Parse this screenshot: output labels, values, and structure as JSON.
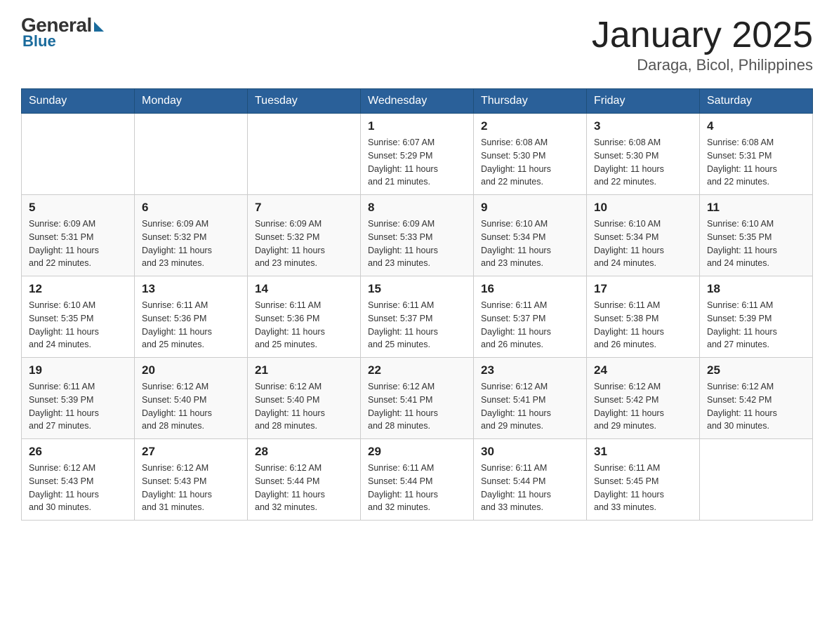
{
  "logo": {
    "general": "General",
    "blue": "Blue"
  },
  "title": "January 2025",
  "location": "Daraga, Bicol, Philippines",
  "days_of_week": [
    "Sunday",
    "Monday",
    "Tuesday",
    "Wednesday",
    "Thursday",
    "Friday",
    "Saturday"
  ],
  "weeks": [
    [
      {
        "day": "",
        "info": ""
      },
      {
        "day": "",
        "info": ""
      },
      {
        "day": "",
        "info": ""
      },
      {
        "day": "1",
        "info": "Sunrise: 6:07 AM\nSunset: 5:29 PM\nDaylight: 11 hours\nand 21 minutes."
      },
      {
        "day": "2",
        "info": "Sunrise: 6:08 AM\nSunset: 5:30 PM\nDaylight: 11 hours\nand 22 minutes."
      },
      {
        "day": "3",
        "info": "Sunrise: 6:08 AM\nSunset: 5:30 PM\nDaylight: 11 hours\nand 22 minutes."
      },
      {
        "day": "4",
        "info": "Sunrise: 6:08 AM\nSunset: 5:31 PM\nDaylight: 11 hours\nand 22 minutes."
      }
    ],
    [
      {
        "day": "5",
        "info": "Sunrise: 6:09 AM\nSunset: 5:31 PM\nDaylight: 11 hours\nand 22 minutes."
      },
      {
        "day": "6",
        "info": "Sunrise: 6:09 AM\nSunset: 5:32 PM\nDaylight: 11 hours\nand 23 minutes."
      },
      {
        "day": "7",
        "info": "Sunrise: 6:09 AM\nSunset: 5:32 PM\nDaylight: 11 hours\nand 23 minutes."
      },
      {
        "day": "8",
        "info": "Sunrise: 6:09 AM\nSunset: 5:33 PM\nDaylight: 11 hours\nand 23 minutes."
      },
      {
        "day": "9",
        "info": "Sunrise: 6:10 AM\nSunset: 5:34 PM\nDaylight: 11 hours\nand 23 minutes."
      },
      {
        "day": "10",
        "info": "Sunrise: 6:10 AM\nSunset: 5:34 PM\nDaylight: 11 hours\nand 24 minutes."
      },
      {
        "day": "11",
        "info": "Sunrise: 6:10 AM\nSunset: 5:35 PM\nDaylight: 11 hours\nand 24 minutes."
      }
    ],
    [
      {
        "day": "12",
        "info": "Sunrise: 6:10 AM\nSunset: 5:35 PM\nDaylight: 11 hours\nand 24 minutes."
      },
      {
        "day": "13",
        "info": "Sunrise: 6:11 AM\nSunset: 5:36 PM\nDaylight: 11 hours\nand 25 minutes."
      },
      {
        "day": "14",
        "info": "Sunrise: 6:11 AM\nSunset: 5:36 PM\nDaylight: 11 hours\nand 25 minutes."
      },
      {
        "day": "15",
        "info": "Sunrise: 6:11 AM\nSunset: 5:37 PM\nDaylight: 11 hours\nand 25 minutes."
      },
      {
        "day": "16",
        "info": "Sunrise: 6:11 AM\nSunset: 5:37 PM\nDaylight: 11 hours\nand 26 minutes."
      },
      {
        "day": "17",
        "info": "Sunrise: 6:11 AM\nSunset: 5:38 PM\nDaylight: 11 hours\nand 26 minutes."
      },
      {
        "day": "18",
        "info": "Sunrise: 6:11 AM\nSunset: 5:39 PM\nDaylight: 11 hours\nand 27 minutes."
      }
    ],
    [
      {
        "day": "19",
        "info": "Sunrise: 6:11 AM\nSunset: 5:39 PM\nDaylight: 11 hours\nand 27 minutes."
      },
      {
        "day": "20",
        "info": "Sunrise: 6:12 AM\nSunset: 5:40 PM\nDaylight: 11 hours\nand 28 minutes."
      },
      {
        "day": "21",
        "info": "Sunrise: 6:12 AM\nSunset: 5:40 PM\nDaylight: 11 hours\nand 28 minutes."
      },
      {
        "day": "22",
        "info": "Sunrise: 6:12 AM\nSunset: 5:41 PM\nDaylight: 11 hours\nand 28 minutes."
      },
      {
        "day": "23",
        "info": "Sunrise: 6:12 AM\nSunset: 5:41 PM\nDaylight: 11 hours\nand 29 minutes."
      },
      {
        "day": "24",
        "info": "Sunrise: 6:12 AM\nSunset: 5:42 PM\nDaylight: 11 hours\nand 29 minutes."
      },
      {
        "day": "25",
        "info": "Sunrise: 6:12 AM\nSunset: 5:42 PM\nDaylight: 11 hours\nand 30 minutes."
      }
    ],
    [
      {
        "day": "26",
        "info": "Sunrise: 6:12 AM\nSunset: 5:43 PM\nDaylight: 11 hours\nand 30 minutes."
      },
      {
        "day": "27",
        "info": "Sunrise: 6:12 AM\nSunset: 5:43 PM\nDaylight: 11 hours\nand 31 minutes."
      },
      {
        "day": "28",
        "info": "Sunrise: 6:12 AM\nSunset: 5:44 PM\nDaylight: 11 hours\nand 32 minutes."
      },
      {
        "day": "29",
        "info": "Sunrise: 6:11 AM\nSunset: 5:44 PM\nDaylight: 11 hours\nand 32 minutes."
      },
      {
        "day": "30",
        "info": "Sunrise: 6:11 AM\nSunset: 5:44 PM\nDaylight: 11 hours\nand 33 minutes."
      },
      {
        "day": "31",
        "info": "Sunrise: 6:11 AM\nSunset: 5:45 PM\nDaylight: 11 hours\nand 33 minutes."
      },
      {
        "day": "",
        "info": ""
      }
    ]
  ]
}
